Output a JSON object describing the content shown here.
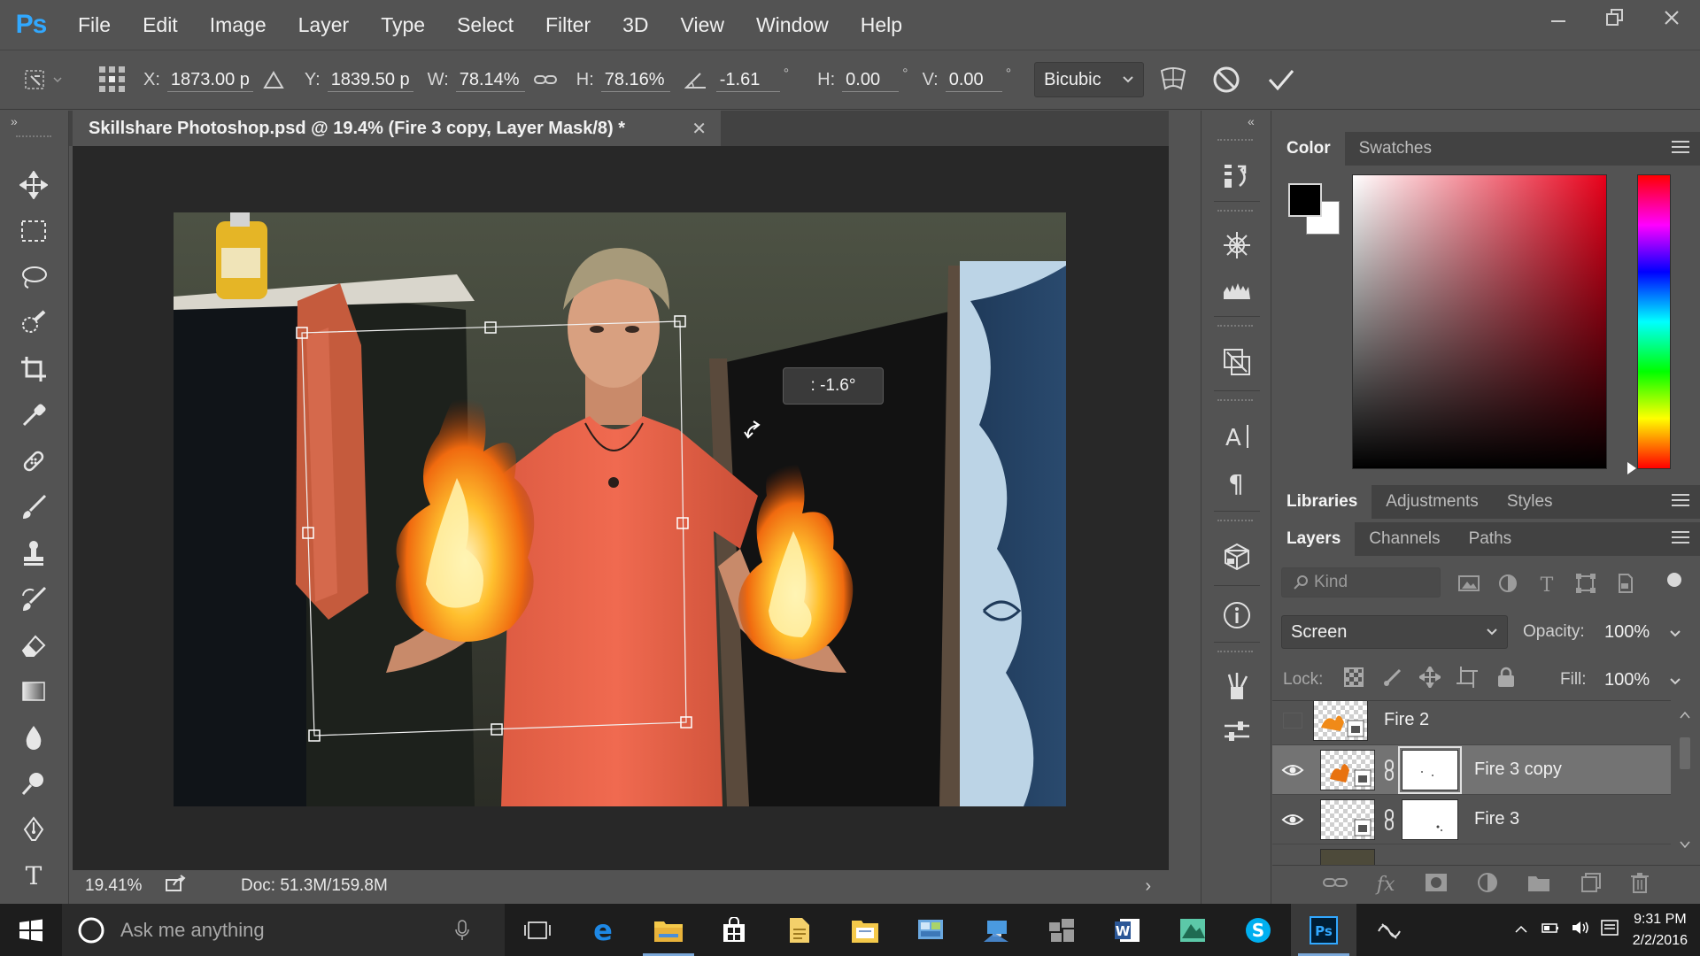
{
  "app": {
    "logo": "Ps"
  },
  "menu": [
    "File",
    "Edit",
    "Image",
    "Layer",
    "Type",
    "Select",
    "Filter",
    "3D",
    "View",
    "Window",
    "Help"
  ],
  "options": {
    "x_label": "X:",
    "x_value": "1873.00 p",
    "y_label": "Y:",
    "y_value": "1839.50 p",
    "w_label": "W:",
    "w_value": "78.14%",
    "h_label": "H:",
    "h_value": "78.16%",
    "angle_value": "-1.61",
    "angle_unit": "°",
    "skew_h_label": "H:",
    "skew_h_value": "0.00",
    "skew_h_unit": "°",
    "skew_v_label": "V:",
    "skew_v_value": "0.00",
    "skew_v_unit": "°",
    "interpolation": "Bicubic"
  },
  "document": {
    "tab_title": "Skillshare Photoshop.psd @ 19.4% (Fire 3 copy, Layer Mask/8) *",
    "rotation_tooltip": ":  -1.6°",
    "zoom": "19.41%",
    "doc_size": "Doc: 51.3M/159.8M"
  },
  "color_panel": {
    "tabs": [
      "Color",
      "Swatches"
    ],
    "foreground": "#000000",
    "background": "#ffffff"
  },
  "libraries_panel": {
    "tabs": [
      "Libraries",
      "Adjustments",
      "Styles"
    ]
  },
  "layers_panel": {
    "tabs": [
      "Layers",
      "Channels",
      "Paths"
    ],
    "filter_placeholder": "Kind",
    "blend_mode": "Screen",
    "opacity_label": "Opacity:",
    "opacity_value": "100%",
    "lock_label": "Lock:",
    "fill_label": "Fill:",
    "fill_value": "100%",
    "layers": [
      {
        "name": "Fire 2",
        "visible": false,
        "selected": false
      },
      {
        "name": "Fire 3 copy",
        "visible": true,
        "selected": true
      },
      {
        "name": "Fire 3",
        "visible": true,
        "selected": false
      }
    ]
  },
  "taskbar": {
    "search_placeholder": "Ask me anything",
    "time": "9:31 PM",
    "date": "2/2/2016"
  },
  "colors": {
    "ps_blue": "#31a8ff",
    "panel_bg": "#535353",
    "canvas_bg": "#282828",
    "taskbar_bg": "#1d1d1d"
  }
}
